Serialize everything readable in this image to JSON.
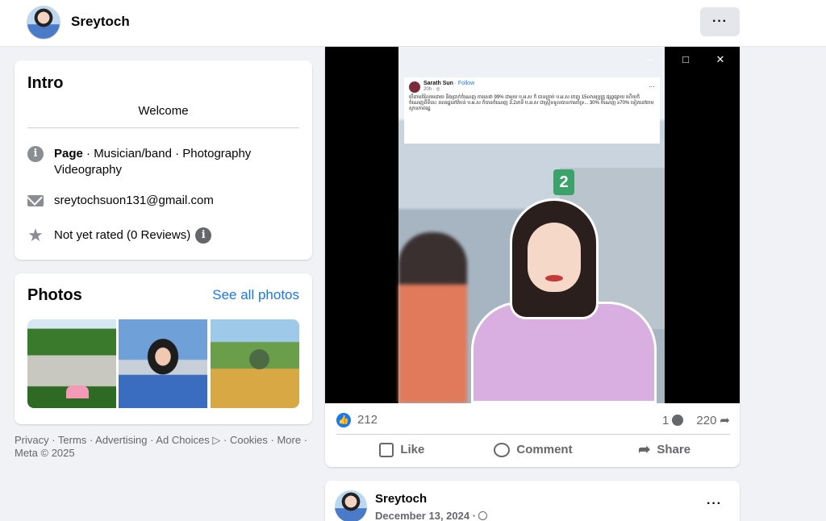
{
  "header": {
    "name": "Sreytoch",
    "more_label": "···"
  },
  "intro": {
    "title": "Intro",
    "bio": "Welcome",
    "page_label": "Page",
    "categories_line1": " · Musician/band · Photography",
    "categories_line2": "Videography",
    "email": "sreytochsuon131@gmail.com",
    "rating": "Not yet rated (0 Reviews)",
    "icons": [
      "info-icon",
      "envelope-icon",
      "star-icon"
    ]
  },
  "photos": {
    "title": "Photos",
    "see_all": "See all photos"
  },
  "footer": {
    "text": "Privacy · Terms · Advertising · Ad Choices ▷ · Cookies · More · Meta © 2025"
  },
  "post": {
    "overlay": {
      "author": "Sarath Sun",
      "follow": "· Follow",
      "time": "20h · ◎",
      "text": "បើតាមតំលៃមេដាយ និងប្រាក់ចំណេញ ការសេវា 99% ជាមួយ ប.អ.ស ក៏ ​បានគ្រាប់ ប.អ.ស ចេញ​ 15លានប្រូត្រូ ផ្សព្វផ្សាយ ហើយក៏ចំណេញពីទីនេះ ពលរដ្ឋនៅតំបន់ ប.អ.ស ក៏បានចំណេញ 3.2នាទី ប.អ.ស ជាស្ត្រីទទួលបានការគាំទ្រ... 30% ចំណេញ ≥70% ទៀតនៅតាមស្ថានភាពរដ្ឋ"
    },
    "likes": "212",
    "comments": "1",
    "shares": "220",
    "actions": {
      "like": "Like",
      "comment": "Comment",
      "share": "Share"
    },
    "sign_number": "2"
  },
  "next_post": {
    "author": "Sreytoch",
    "date": "December 13, 2024 ·",
    "more_label": "···"
  }
}
